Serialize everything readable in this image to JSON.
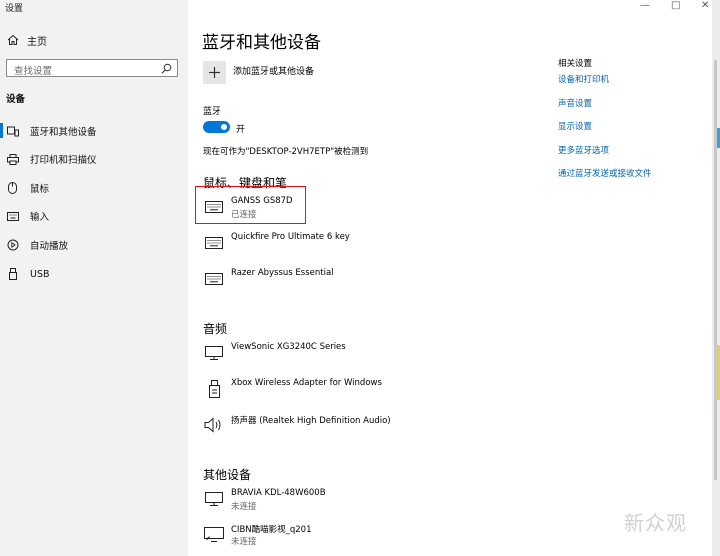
{
  "window": {
    "title": "设置",
    "controls": [
      "—",
      "□",
      "✕"
    ]
  },
  "sidebar": {
    "home_label": "主页",
    "search_placeholder": "查找设置",
    "section_title": "设备",
    "items": [
      {
        "label": "蓝牙和其他设备",
        "icon": "bluetooth-devices-icon"
      },
      {
        "label": "打印机和扫描仪",
        "icon": "printer-icon"
      },
      {
        "label": "鼠标",
        "icon": "mouse-icon"
      },
      {
        "label": "输入",
        "icon": "keyboard-icon"
      },
      {
        "label": "自动播放",
        "icon": "autoplay-icon"
      },
      {
        "label": "USB",
        "icon": "usb-icon"
      }
    ]
  },
  "main": {
    "title": "蓝牙和其他设备",
    "add_device_label": "添加蓝牙或其他设备",
    "bluetooth_label": "蓝牙",
    "bluetooth_state": "开",
    "discoverable_text": "现在可作为\"DESKTOP-2VH7ETP\"被检测到",
    "sections": [
      {
        "title": "鼠标、键盘和笔",
        "devices": [
          {
            "name": "GANSS  GS87D",
            "status": "已连接",
            "icon": "keyboard-icon"
          },
          {
            "name": "Quickfire Pro Ultimate 6 key",
            "status": "",
            "icon": "keyboard-icon"
          },
          {
            "name": "Razer Abyssus Essential",
            "status": "",
            "icon": "keyboard-icon"
          }
        ]
      },
      {
        "title": "音频",
        "devices": [
          {
            "name": "ViewSonic XG3240C Series",
            "status": "",
            "icon": "monitor-icon"
          },
          {
            "name": "Xbox Wireless Adapter for Windows",
            "status": "",
            "icon": "wireless-adapter-icon"
          },
          {
            "name": "扬声器 (Realtek High Definition Audio)",
            "status": "",
            "icon": "speaker-icon"
          }
        ]
      },
      {
        "title": "其他设备",
        "devices": [
          {
            "name": "BRAVIA KDL-48W600B",
            "status": "未连接",
            "icon": "monitor-icon"
          },
          {
            "name": "CIBN酷喵影视_q201",
            "status": "未连接",
            "icon": "cast-display-icon"
          }
        ]
      }
    ]
  },
  "related": {
    "title": "相关设置",
    "links": [
      "设备和打印机",
      "声音设置",
      "显示设置",
      "更多蓝牙选项",
      "通过蓝牙发送或接收文件"
    ]
  },
  "watermark": "新众观",
  "colors": {
    "accent": "#0078d7",
    "link": "#0063b1",
    "highlight": "#e11111",
    "sidebar_bg": "#f2f2f2"
  }
}
